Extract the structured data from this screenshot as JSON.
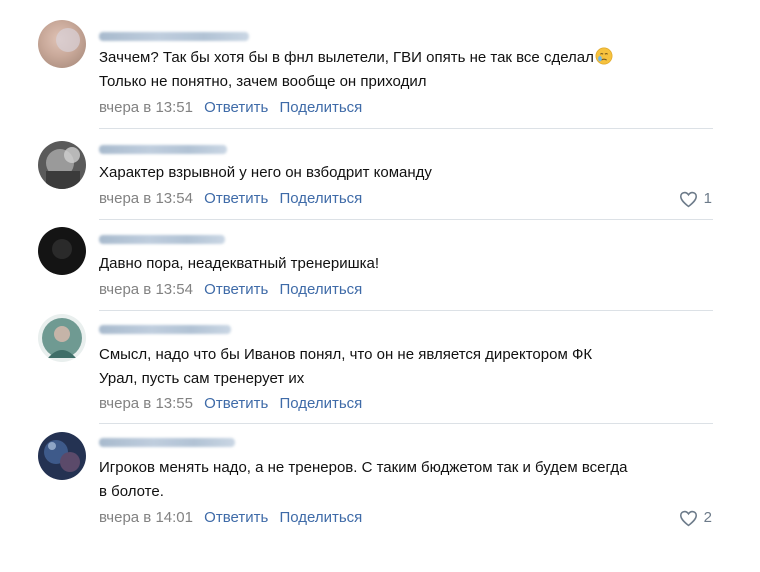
{
  "comments": [
    {
      "text_lines": [
        "Заччем? Так бы хотя бы в фнл вылетели, ГВИ опять не так все сделал",
        "Только не понятно, зачем вообще он приходил"
      ],
      "emoji": "sad-face-icon",
      "time": "вчера в 13:51",
      "reply": "Ответить",
      "share": "Поделиться",
      "likes": null,
      "avatar_color": "#c9a99a"
    },
    {
      "text_lines": [
        "Характер взрывной у него он взбодрит команду"
      ],
      "time": "вчера в 13:54",
      "reply": "Ответить",
      "share": "Поделиться",
      "likes": "1",
      "avatar_color": "#6e6e6e"
    },
    {
      "text_lines": [
        "Давно пора, неадекватный тренеришка!"
      ],
      "time": "вчера в 13:54",
      "reply": "Ответить",
      "share": "Поделиться",
      "likes": null,
      "avatar_color": "#1a1a1a"
    },
    {
      "text_lines": [
        "Смысл, надо что бы Иванов понял, что он не является директором ФК",
        "Урал, пусть сам тренерует их"
      ],
      "time": "вчера в 13:55",
      "reply": "Ответить",
      "share": "Поделиться",
      "likes": null,
      "avatar_color": "#5f8d85"
    },
    {
      "text_lines": [
        "Игроков менять надо, а не тренеров. С таким бюджетом так и будем всегда",
        "в болоте."
      ],
      "time": "вчера в 14:01",
      "reply": "Ответить",
      "share": "Поделиться",
      "likes": "2",
      "avatar_color": "#3b4f74"
    }
  ],
  "colors": {
    "link": "#3f6ba8",
    "meta": "#828282",
    "like": "#6d7b8a"
  }
}
